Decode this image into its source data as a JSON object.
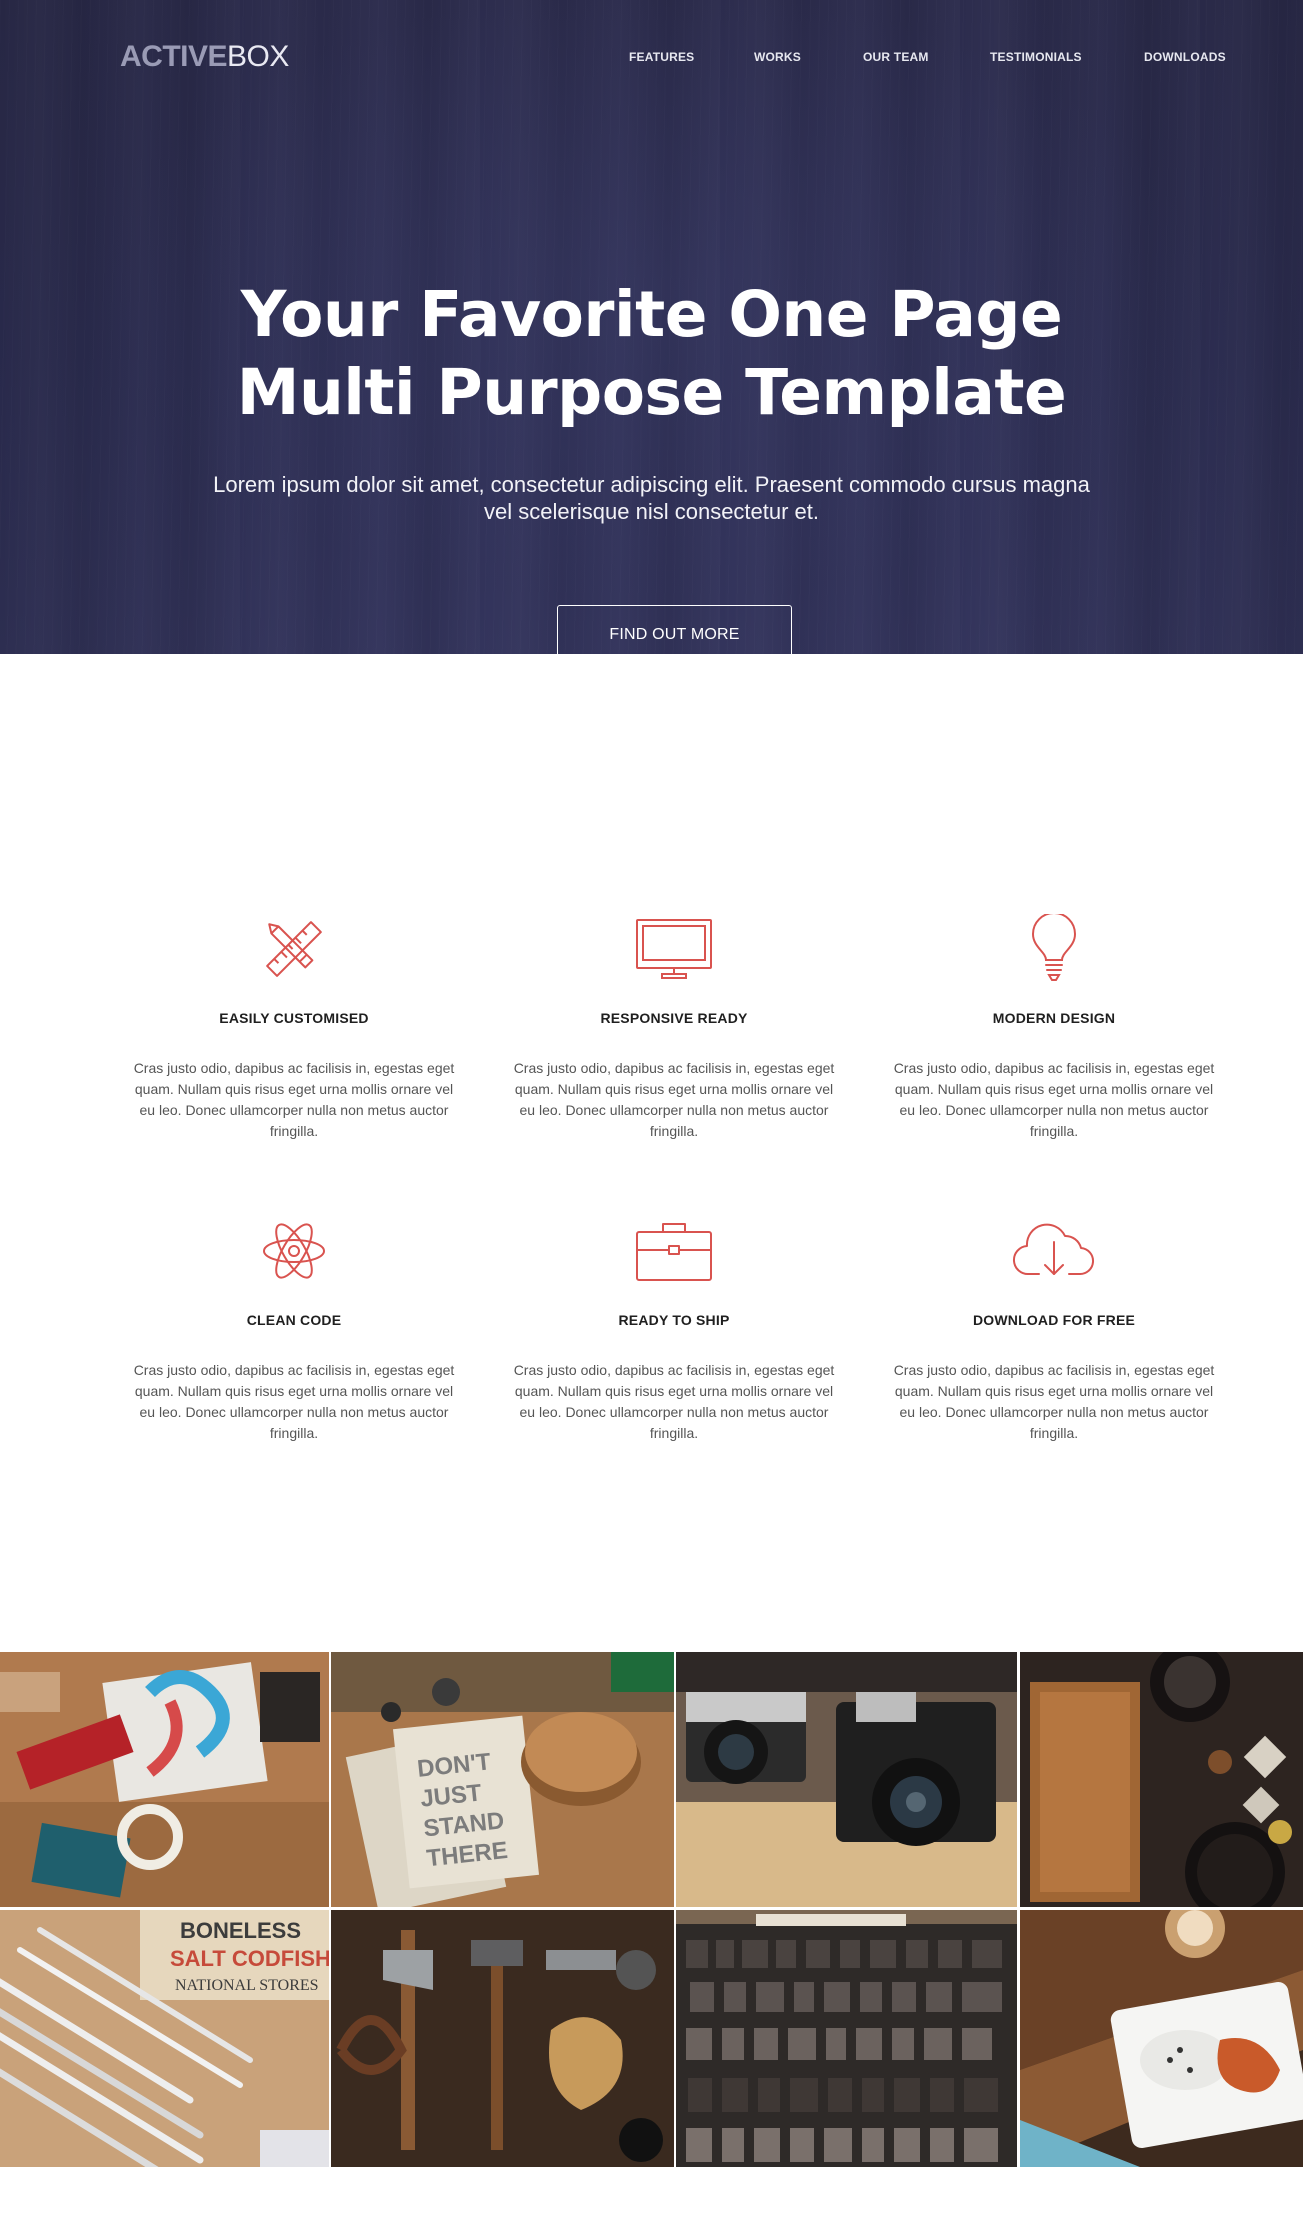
{
  "header": {
    "logo_bold": "ACTIVE",
    "logo_light": "BOX",
    "nav": [
      "FEATURES",
      "WORKS",
      "OUR TEAM",
      "TESTIMONIALS",
      "DOWNLOADS"
    ]
  },
  "hero": {
    "title_line1": "Your Favorite One Page",
    "title_line2": "Multi Purpose Template",
    "subtitle": "Lorem ipsum dolor sit amet, consectetur adipiscing elit. Praesent commodo cursus magna vel scelerisque nisl consectetur et.",
    "button": "FIND OUT MORE"
  },
  "features": [
    {
      "icon": "pencil-ruler-icon",
      "title": "EASILY CUSTOMISED",
      "text": "Cras justo odio, dapibus ac facilisis in, egestas eget quam. Nullam quis risus eget urna mollis ornare vel eu leo. Donec ullamcorper nulla non metus auctor fringilla."
    },
    {
      "icon": "monitor-icon",
      "title": "RESPONSIVE READY",
      "text": "Cras justo odio, dapibus ac facilisis in, egestas eget quam. Nullam quis risus eget urna mollis ornare vel eu leo. Donec ullamcorper nulla non metus auctor fringilla."
    },
    {
      "icon": "lightbulb-icon",
      "title": "MODERN DESIGN",
      "text": "Cras justo odio, dapibus ac facilisis in, egestas eget quam. Nullam quis risus eget urna mollis ornare vel eu leo. Donec ullamcorper nulla non metus auctor fringilla."
    },
    {
      "icon": "atom-icon",
      "title": "CLEAN CODE",
      "text": "Cras justo odio, dapibus ac facilisis in, egestas eget quam. Nullam quis risus eget urna mollis ornare vel eu leo. Donec ullamcorper nulla non metus auctor fringilla."
    },
    {
      "icon": "briefcase-icon",
      "title": "READY TO SHIP",
      "text": "Cras justo odio, dapibus ac facilisis in, egestas eget quam. Nullam quis risus eget urna mollis ornare vel eu leo. Donec ullamcorper nulla non metus auctor fringilla."
    },
    {
      "icon": "cloud-download-icon",
      "title": "DOWNLOAD FOR FREE",
      "text": "Cras justo odio, dapibus ac facilisis in, egestas eget quam. Nullam quis risus eget urna mollis ornare vel eu leo. Donec ullamcorper nulla non metus auctor fringilla."
    }
  ],
  "gallery": [
    {
      "name": "gallery-photo-design-kit"
    },
    {
      "name": "gallery-photo-notebooks-coasters"
    },
    {
      "name": "gallery-photo-vintage-cameras"
    },
    {
      "name": "gallery-photo-cutting-board-spices"
    },
    {
      "name": "gallery-photo-pencils-sign"
    },
    {
      "name": "gallery-photo-tools"
    },
    {
      "name": "gallery-photo-letterpress-type"
    },
    {
      "name": "gallery-photo-food-plate"
    }
  ],
  "colors": {
    "hero_bg": "#2e2f55",
    "accent": "#d9534f",
    "heading": "#1f1f1f",
    "body_text": "#555555"
  }
}
